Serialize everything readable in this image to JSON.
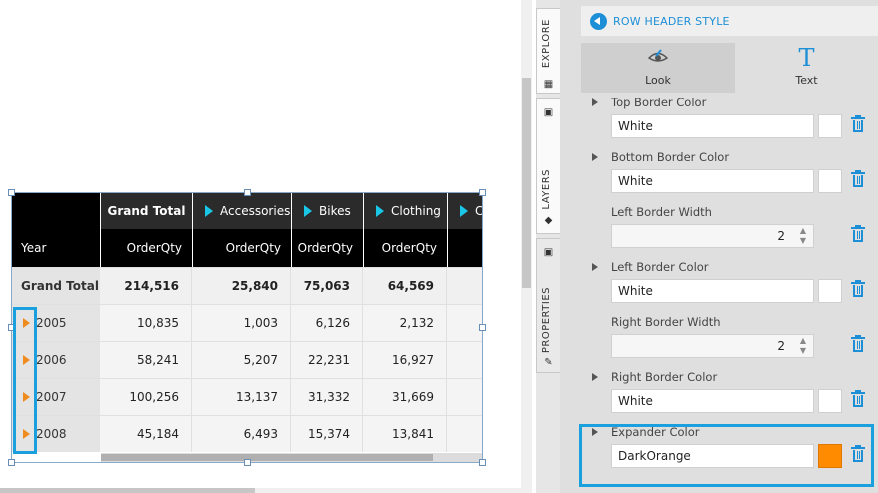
{
  "crosstab": {
    "row_header_label": "Year",
    "columns_level1": [
      {
        "label": "Grand Total",
        "expander": false
      },
      {
        "label": "Accessories",
        "expander": true
      },
      {
        "label": "Bikes",
        "expander": true
      },
      {
        "label": "Clothing",
        "expander": true
      },
      {
        "label": "Co",
        "expander": true
      }
    ],
    "measure_label": "OrderQty",
    "grand_total_row": {
      "label": "Grand Total",
      "values": [
        "214,516",
        "25,840",
        "75,063",
        "64,569"
      ]
    },
    "rows": [
      {
        "label": "2005",
        "values": [
          "10,835",
          "1,003",
          "6,126",
          "2,132"
        ]
      },
      {
        "label": "2006",
        "values": [
          "58,241",
          "5,207",
          "22,231",
          "16,927"
        ]
      },
      {
        "label": "2007",
        "values": [
          "100,256",
          "13,137",
          "31,332",
          "31,669"
        ]
      },
      {
        "label": "2008",
        "values": [
          "45,184",
          "6,493",
          "15,374",
          "13,841"
        ]
      }
    ],
    "expander_color": "#f08c1e",
    "column_expander_color": "#19c6e6"
  },
  "vtabs": [
    {
      "label": "EXPLORE",
      "icon": "book-icon"
    },
    {
      "label": "LAYERS",
      "icon": "layers-icon"
    },
    {
      "label": "PROPERTIES",
      "icon": "brush-icon"
    }
  ],
  "panel": {
    "title": "ROW HEADER STYLE",
    "tabs": [
      {
        "label": "Look",
        "icon": "eye-icon"
      },
      {
        "label": "Text",
        "icon": "text-icon"
      }
    ],
    "properties": [
      {
        "label": "Top Border Color",
        "type": "color",
        "value": "White",
        "swatch": "#ffffff",
        "expandable": true
      },
      {
        "label": "Bottom Border Color",
        "type": "color",
        "value": "White",
        "swatch": "#ffffff",
        "expandable": true
      },
      {
        "label": "Left Border Width",
        "type": "number",
        "value": "2",
        "expandable": false
      },
      {
        "label": "Left Border Color",
        "type": "color",
        "value": "White",
        "swatch": "#ffffff",
        "expandable": true
      },
      {
        "label": "Right Border Width",
        "type": "number",
        "value": "2",
        "expandable": false
      },
      {
        "label": "Right Border Color",
        "type": "color",
        "value": "White",
        "swatch": "#ffffff",
        "expandable": true
      },
      {
        "label": "Expander Color",
        "type": "color",
        "value": "DarkOrange",
        "swatch": "#ff8c00",
        "expandable": true
      }
    ],
    "accent_color": "#1d8fd6"
  }
}
